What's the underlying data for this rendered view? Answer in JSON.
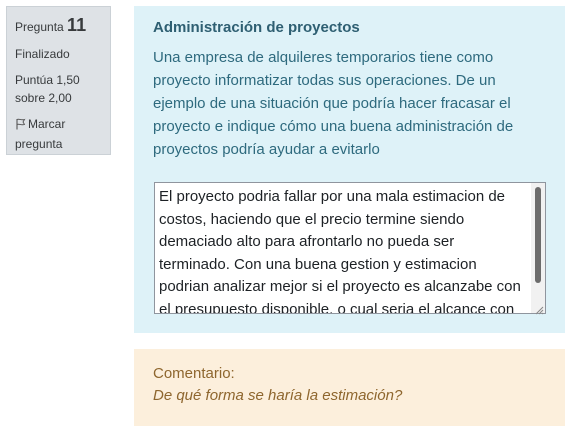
{
  "info": {
    "question_label": "Pregunta",
    "question_number": "11",
    "state": "Finalizado",
    "grade_line1": "Puntúa 1,50",
    "grade_line2": "sobre 2,00",
    "flag_line1": "Marcar",
    "flag_line2": "pregunta",
    "flag_icon": "flag-icon"
  },
  "question": {
    "title": "Administración de proyectos",
    "text": "Una empresa de alquileres temporarios tiene como proyecto informatizar todas sus operaciones. De un ejemplo de una situación que podría hacer fracasar el proyecto e indique cómo una buena administración de proyectos podría ayudar a evitarlo",
    "answer": "El proyecto podria fallar por una mala estimacion de costos, haciendo que el precio termine siendo demaciado alto para afrontarlo no pueda ser terminado. Con una buena gestion y estimacion podrian analizar mejor si el proyecto es alcanzabe con el presupuesto disponible, o cual seria el alcance con este"
  },
  "comment": {
    "label": "Comentario:",
    "text": "De qué forma se haría la estimación?"
  },
  "colors": {
    "info_bg": "#dee2e6",
    "formulation_bg": "#def2f8",
    "formulation_text": "#2e6a7e",
    "comment_bg": "#fcefdc",
    "comment_text": "#8e662e"
  }
}
